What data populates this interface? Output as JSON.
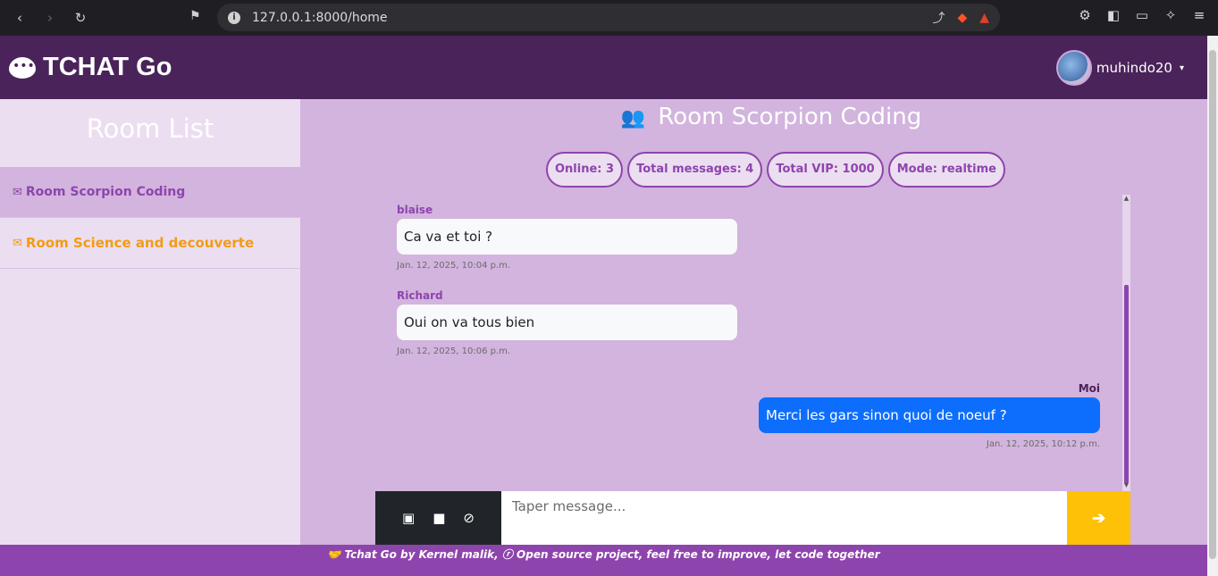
{
  "browser": {
    "url": "127.0.0.1:8000/home",
    "nav": {
      "back_icon": "‹",
      "forward_icon": "›",
      "reload_icon": "↻",
      "bookmark_icon": "⚑"
    },
    "info_icon": "i",
    "addr_icons": [
      "⤴",
      "◆",
      "▲"
    ],
    "tools": [
      "⚙",
      "◧",
      "▭",
      "✧",
      "≡"
    ]
  },
  "navbar": {
    "title": "TCHAT Go",
    "username": "muhindo20",
    "caret": "▾"
  },
  "sidebar": {
    "heading": "Room List",
    "rooms": [
      {
        "label": "Room Scorpion Coding",
        "icon": "✉"
      },
      {
        "label": "Room Science and decouverte",
        "icon": "✉"
      }
    ]
  },
  "main": {
    "room_title": "Room Scorpion Coding",
    "people_icon": "👥",
    "stats": {
      "online": "Online: 3",
      "total_messages": "Total messages: 4",
      "total_vip": "Total VIP: 1000",
      "mode": "Mode: realtime"
    },
    "messages": [
      {
        "sender": "blaise",
        "text": "Ca va et toi ?",
        "time": "Jan. 12, 2025, 10:04 p.m.",
        "mine": false
      },
      {
        "sender": "Richard",
        "text": "Oui on va tous bien",
        "time": "Jan. 12, 2025, 10:06 p.m.",
        "mine": false
      },
      {
        "sender": "Moi",
        "text": "Merci les gars sinon quoi de noeuf ?",
        "time": "Jan. 12, 2025, 10:12 p.m.",
        "mine": true
      }
    ],
    "scroll_up": "▲",
    "scroll_down": "▼"
  },
  "composer": {
    "placeholder": "Taper message...",
    "image_icon": "▣",
    "video_icon": "■",
    "attach_icon": "⊘",
    "send_icon": "➔"
  },
  "footer": {
    "text": "🤝 Tchat Go by Kernel malik, ⓡ Open source project, feel free to improve, let code together"
  },
  "colors": {
    "navbar": "#4a235a",
    "accent": "#8e44ad",
    "sidebar_bg": "#ebdef0",
    "main_bg": "#d2b4de",
    "send_button": "#ffc107",
    "my_bubble": "#0d6efd",
    "room_other": "#f39c12"
  }
}
